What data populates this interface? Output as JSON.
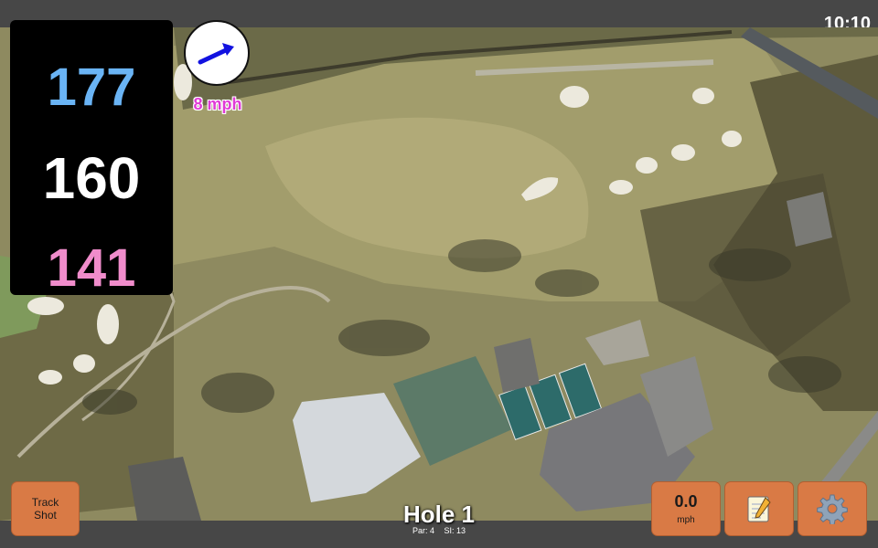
{
  "status_bar": {
    "time": "10:10"
  },
  "distances": {
    "back": "177",
    "middle": "160",
    "front": "141",
    "colors": {
      "back": "#6ab4f5",
      "middle": "#ffffff",
      "front": "#f08ccb"
    }
  },
  "wind": {
    "speed_label": "8 mph",
    "icon": "wind-direction-arrow-icon",
    "arrow_color": "#1212e0"
  },
  "buttons": {
    "track_shot": {
      "line1": "Track",
      "line2": "Shot"
    },
    "wind_speed": {
      "value": "0.0",
      "unit": "mph"
    },
    "notes": {
      "icon": "notepad-icon"
    },
    "settings": {
      "icon": "gear-icon"
    }
  },
  "hole": {
    "title": "Hole 1",
    "par": "Par: 4",
    "si": "SI: 13"
  },
  "colors": {
    "button": "#d97a45",
    "bar": "#474747",
    "wind_label": "#e03ad7"
  }
}
